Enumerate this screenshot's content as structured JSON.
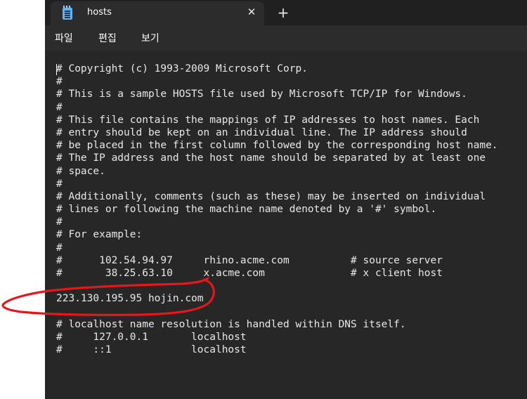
{
  "tab": {
    "title": "hosts",
    "close_glyph": "✕",
    "new_tab_glyph": "+"
  },
  "menu": {
    "items": [
      "파일",
      "편집",
      "보기"
    ]
  },
  "editor": {
    "lines": [
      "# Copyright (c) 1993-2009 Microsoft Corp.",
      "#",
      "# This is a sample HOSTS file used by Microsoft TCP/IP for Windows.",
      "#",
      "# This file contains the mappings of IP addresses to host names. Each",
      "# entry should be kept on an individual line. The IP address should",
      "# be placed in the first column followed by the corresponding host name.",
      "# The IP address and the host name should be separated by at least one",
      "# space.",
      "#",
      "# Additionally, comments (such as these) may be inserted on individual",
      "# lines or following the machine name denoted by a '#' symbol.",
      "#",
      "# For example:",
      "#",
      "#      102.54.94.97     rhino.acme.com          # source server",
      "#       38.25.63.10     x.acme.com              # x client host",
      "",
      "223.130.195.95 hojin.com",
      "",
      "# localhost name resolution is handled within DNS itself.",
      "#     127.0.0.1       localhost",
      "#     ::1             localhost"
    ]
  },
  "colors": {
    "editor_bg": "#272727",
    "titlebar_bg": "#202020",
    "annotation_stroke": "#e8161b"
  },
  "icons": {
    "app": "notepad-icon",
    "close": "close-icon",
    "new_tab": "plus-icon"
  }
}
